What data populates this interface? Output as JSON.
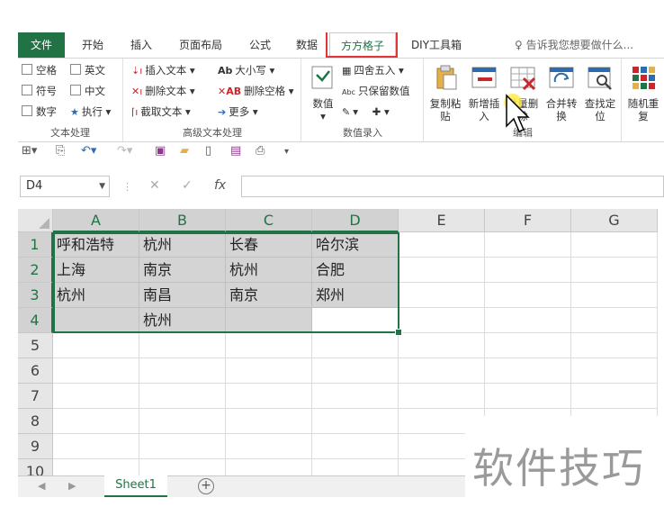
{
  "tabs": {
    "file": "文件",
    "home": "开始",
    "insert": "插入",
    "layout": "页面布局",
    "formulas": "公式",
    "data": "数据",
    "fangfang": "方方格子",
    "diy": "DIY工具箱",
    "tell_me": "告诉我您想要做什么..."
  },
  "ribbon": {
    "text_group": {
      "label": "文本处理",
      "options": [
        "空格",
        "英文",
        "符号",
        "中文",
        "数字"
      ],
      "execute": "执行"
    },
    "adv_text_group": {
      "label": "高级文本处理",
      "insert_text": "插入文本",
      "delete_text": "删除文本",
      "extract_text": "截取文本",
      "case": "大小写",
      "delete_space": "删除空格",
      "more": "更多"
    },
    "number_group": {
      "label": "数值录入",
      "numeric": "数值",
      "round": "四舍五入",
      "keep_value": "只保留数值"
    },
    "edit_group": {
      "label": "编辑",
      "copy_paste": "复制粘贴",
      "new_insert": "新增插入",
      "batch_delete": "批量删除",
      "merge_convert": "合并转换",
      "find_locate": "查找定位",
      "random_repeat": "随机重复"
    }
  },
  "name_box": "D4",
  "columns": [
    "A",
    "B",
    "C",
    "D",
    "E",
    "F",
    "G"
  ],
  "rows": [
    "1",
    "2",
    "3",
    "4",
    "5",
    "6",
    "7",
    "8",
    "9",
    "10"
  ],
  "cells": [
    [
      "呼和浩特",
      "杭州",
      "长春",
      "哈尔滨"
    ],
    [
      "上海",
      "南京",
      "杭州",
      "合肥"
    ],
    [
      "杭州",
      "南昌",
      "南京",
      "郑州"
    ],
    [
      "",
      "杭州",
      "",
      ""
    ]
  ],
  "sheet_tab": "Sheet1",
  "watermark": "软件技巧",
  "colors": {
    "excel_green": "#217346",
    "highlight_red": "#e2353a",
    "selection_fill": "#d4d4d4"
  }
}
